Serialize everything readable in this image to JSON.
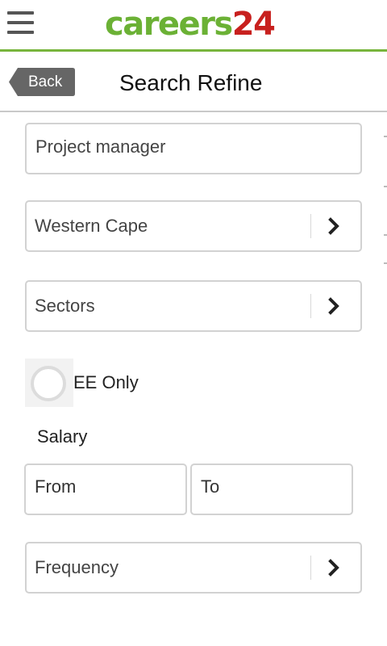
{
  "app": {
    "logo_word": "careers",
    "logo_number": "24",
    "brand_green": "#6bb135",
    "brand_red": "#c8201e",
    "menu_icon": "hamburger-menu-icon"
  },
  "header": {
    "back_label": "Back",
    "title": "Search Refine"
  },
  "form": {
    "keyword_value": "Project manager",
    "location_value": "Western Cape",
    "sectors_value": "Sectors",
    "ee_only_label": "EE Only",
    "ee_only_checked": false,
    "salary_label": "Salary",
    "salary_from": "From",
    "salary_to": "To",
    "frequency_value": "Frequency",
    "chevron_icon": "chevron-right-icon"
  }
}
